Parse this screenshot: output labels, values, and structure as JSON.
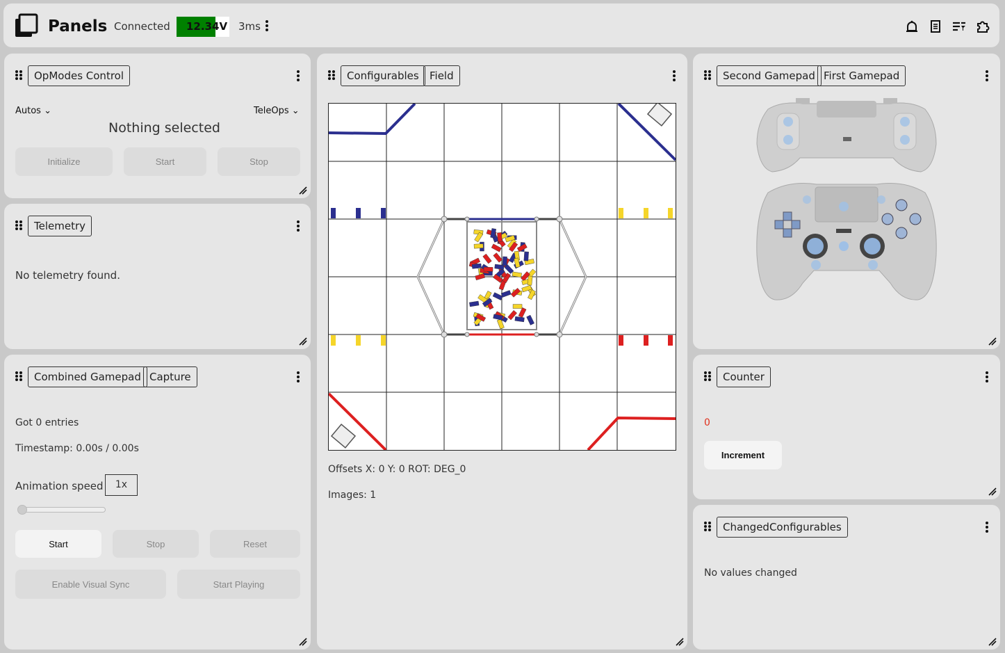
{
  "header": {
    "brand": "Panels",
    "status": "Connected",
    "voltage": "12.34V",
    "voltage_fraction": 0.74,
    "latency": "3ms",
    "icons": [
      "bell-icon",
      "document-icon",
      "filter-list-icon",
      "puzzle-icon"
    ]
  },
  "opmodes": {
    "tab": "OpModes Control",
    "autos_label": "Autos",
    "teleops_label": "TeleOps",
    "status": "Nothing selected",
    "buttons": [
      "Initialize",
      "Start",
      "Stop"
    ]
  },
  "telemetry": {
    "tab": "Telemetry",
    "empty": "No telemetry found."
  },
  "combined": {
    "tabs": [
      "Combined Gamepad",
      "Capture"
    ],
    "entries": "Got 0 entries",
    "timestamp": "Timestamp: 0.00s / 0.00s",
    "speed_label": "Animation speed",
    "speed_value": "1x",
    "slider_value": 0,
    "buttons": [
      "Start",
      "Stop",
      "Reset"
    ],
    "buttons2": [
      "Enable Visual Sync",
      "Start Playing"
    ]
  },
  "field": {
    "tabs": [
      "Configurables",
      "Field"
    ],
    "offsets": "Offsets X: 0 Y: 0 ROT: DEG_0",
    "images": "Images: 1"
  },
  "gamepads": {
    "tabs": [
      "Second Gamepad",
      "First Gamepad"
    ]
  },
  "counter": {
    "tab": "Counter",
    "value": "0",
    "button": "Increment",
    "value_color": "#e0321e"
  },
  "changed": {
    "tab": "ChangedConfigurables",
    "empty": "No values changed"
  },
  "colors": {
    "voltage_ok": "#008000",
    "alliance_blue": "#2b2f8f",
    "alliance_red": "#dd2020",
    "sample_yellow": "#f5d52a"
  }
}
